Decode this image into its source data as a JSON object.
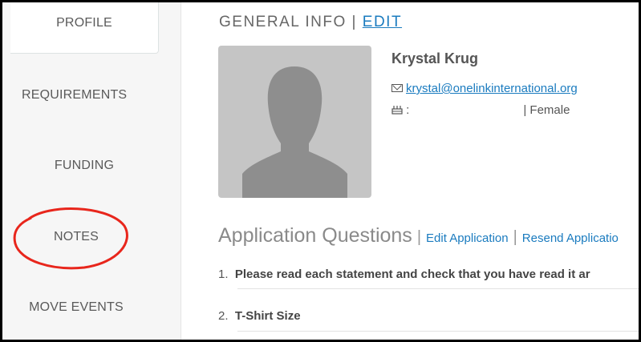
{
  "sidebar": {
    "items": [
      {
        "label": "PROFILE"
      },
      {
        "label": "REQUIREMENTS"
      },
      {
        "label": "FUNDING"
      },
      {
        "label": "NOTES"
      },
      {
        "label": "MOVE EVENTS"
      }
    ]
  },
  "general": {
    "title": "GENERAL INFO",
    "separator": "|",
    "edit_label": "EDIT"
  },
  "profile": {
    "name": "Krystal Krug",
    "email": "krystal@onelinkinternational.org",
    "birthday_prefix": ":",
    "gender_separator": "|",
    "gender": "Female"
  },
  "application": {
    "title": "Application Questions",
    "separator": "|",
    "edit_link": "Edit Application",
    "resend_link": "Resend Applicatio",
    "questions": [
      {
        "number": "1.",
        "text": "Please read each statement and check that you have read it ar"
      },
      {
        "number": "2.",
        "text": "T-Shirt Size"
      }
    ]
  },
  "colors": {
    "link": "#1a7bbf",
    "annotation_circle": "#e8261c",
    "avatar_bg": "#c5c5c5"
  }
}
